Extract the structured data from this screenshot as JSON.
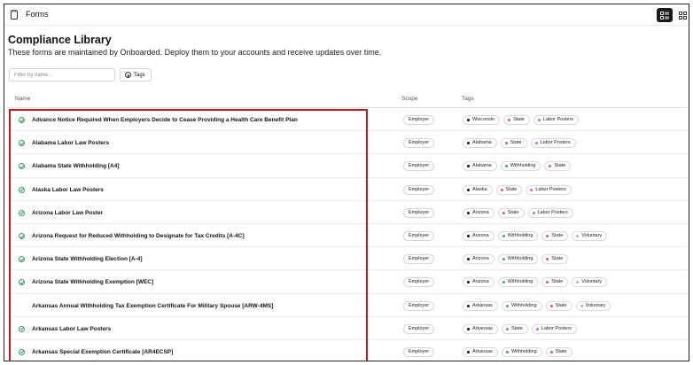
{
  "topbar": {
    "title": "Forms"
  },
  "header": {
    "title": "Compliance Library",
    "subtitle": "These forms are maintained by Onboarded. Deploy them to your accounts and receive updates over time."
  },
  "toolbar": {
    "filter_placeholder": "Filter by name...",
    "tags_label": "Tags"
  },
  "table": {
    "columns": {
      "name": "Name",
      "scope": "Scope",
      "tags": "Tags"
    },
    "rows": [
      {
        "name": "Advance Notice Required When Employers Decide to Cease Providing a Health Care Benefit Plan",
        "checked": true,
        "scope": "Employer",
        "tags": [
          "Wisconsin",
          "State",
          "Labor Posters"
        ]
      },
      {
        "name": "Alabama Labor Law Posters",
        "checked": true,
        "scope": "Employer",
        "tags": [
          "Alabama",
          "State",
          "Labor Posters"
        ]
      },
      {
        "name": "Alabama State Withholding [A4]",
        "checked": true,
        "scope": "Employer",
        "tags": [
          "Alabama",
          "Withholding",
          "State"
        ]
      },
      {
        "name": "Alaska Labor Law Posters",
        "checked": true,
        "scope": "Employer",
        "tags": [
          "Alaska",
          "State",
          "Labor Posters"
        ]
      },
      {
        "name": "Arizona Labor Law Poster",
        "checked": true,
        "scope": "Employer",
        "tags": [
          "Arizona",
          "State",
          "Labor Posters"
        ]
      },
      {
        "name": "Arizona Request for Reduced Withholding to Designate for Tax Credits [A-4C]",
        "checked": true,
        "scope": "Employer",
        "tags": [
          "Arizona",
          "Withholding",
          "State",
          "Voluntary"
        ]
      },
      {
        "name": "Arizona State Withholding Election [A-4]",
        "checked": true,
        "scope": "Employer",
        "tags": [
          "Arizona",
          "Withholding",
          "State"
        ]
      },
      {
        "name": "Arizona State Withholding Exemption [WEC]",
        "checked": true,
        "scope": "Employer",
        "tags": [
          "Arizona",
          "Withholding",
          "State",
          "Voluntary"
        ]
      },
      {
        "name": "Arkansas Annual Withholding Tax Exemption Certificate For Military Spouse [ARW-4MS]",
        "checked": false,
        "scope": "Employer",
        "tags": [
          "Arkansas",
          "Withholding",
          "State",
          "Voluntary"
        ]
      },
      {
        "name": "Arkansas Labor Law Posters",
        "checked": true,
        "scope": "Employer",
        "tags": [
          "Arkansas",
          "State",
          "Labor Posters"
        ]
      },
      {
        "name": "Arkansas Special Exemption Certificate [AR4ECSP]",
        "checked": true,
        "scope": "Employer",
        "tags": [
          "Arkansas",
          "Withholding",
          "State"
        ]
      }
    ]
  },
  "colors": {
    "check": "#3a9a55",
    "highlight": "#c4161c",
    "tag_dots": {
      "State": "#e05a6d",
      "Labor Posters": "#c56ad8",
      "Withholding": "#3aa978",
      "Voluntary": "#9fb7c9",
      "location": "#111111"
    }
  }
}
